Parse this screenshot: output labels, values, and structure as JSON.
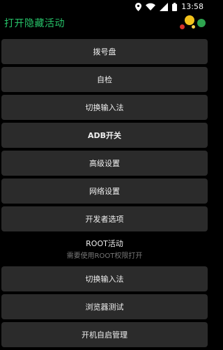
{
  "status_bar": {
    "time": "13:58"
  },
  "app_bar": {
    "title": "打开隐藏活动"
  },
  "menu": {
    "items": [
      {
        "label": "拨号盘"
      },
      {
        "label": "自检"
      },
      {
        "label": "切换输入法"
      },
      {
        "label": "ADB开关"
      },
      {
        "label": "高级设置"
      },
      {
        "label": "网络设置"
      },
      {
        "label": "开发者选项"
      }
    ],
    "root_section": {
      "title": "ROOT活动",
      "subtitle": "需要使用ROOT权限打开"
    },
    "root_items": [
      {
        "label": "切换输入法"
      },
      {
        "label": "浏览器测试"
      },
      {
        "label": "开机自启管理"
      }
    ]
  },
  "colors": {
    "accent_title": "#27c46a",
    "button_bg": "#2b2b2b"
  },
  "icons": [
    "location-icon",
    "wifi-icon",
    "signal-icon",
    "battery-icon"
  ]
}
